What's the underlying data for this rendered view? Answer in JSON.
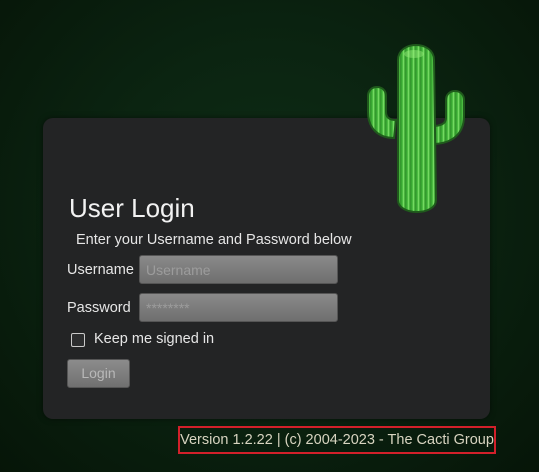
{
  "login": {
    "title": "User Login",
    "subtitle": "Enter your Username and Password below",
    "username_label": "Username",
    "username_placeholder": "Username",
    "password_label": "Password",
    "password_placeholder": "********",
    "keep_signed_in_label": "Keep me signed in",
    "keep_signed_in_checked": false,
    "login_button_label": "Login"
  },
  "footer": {
    "version_text": "Version 1.2.22 | (c) 2004-2023 - The Cacti Group"
  },
  "icons": {
    "logo": "cactus-logo-icon"
  },
  "colors": {
    "background": "#0b2411",
    "panel": "#232425",
    "cactus_green": "#3fb53a",
    "version_border": "#d2202a"
  }
}
